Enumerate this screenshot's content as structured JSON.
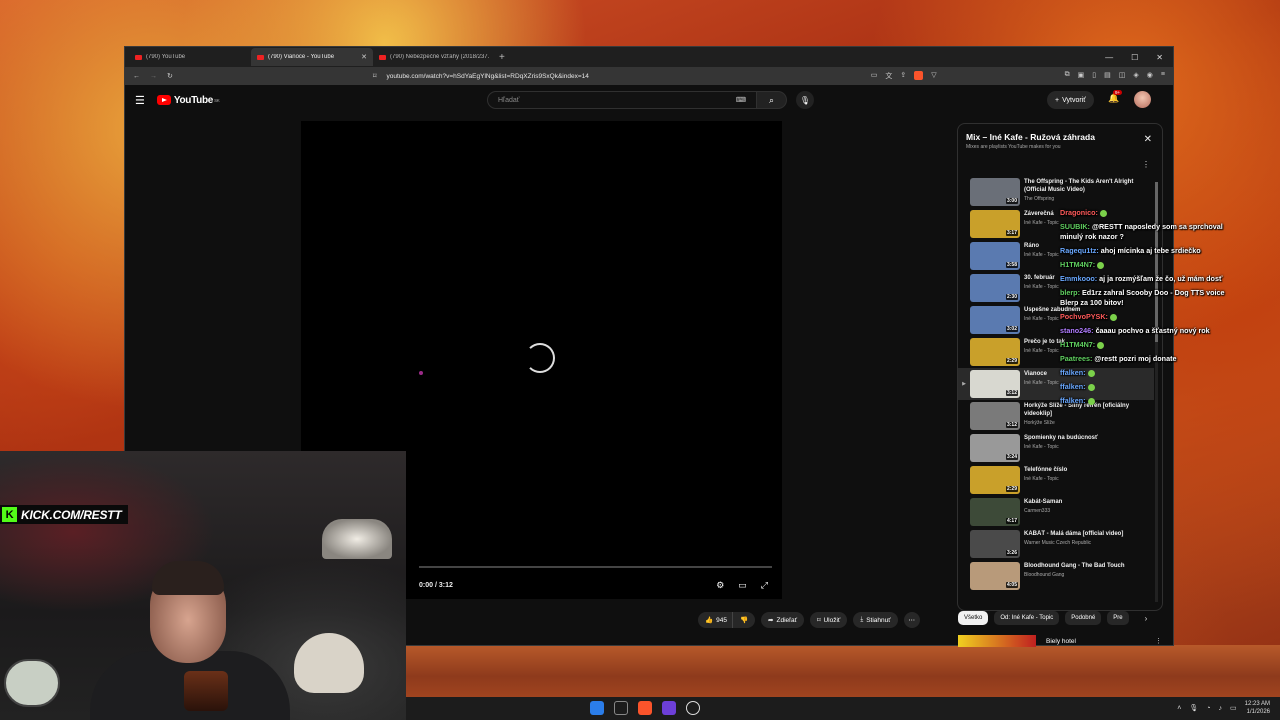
{
  "browser": {
    "tabs": [
      {
        "label": "(790) YouTube",
        "active": false
      },
      {
        "label": "(790) Vianoce - YouTube",
        "active": true
      },
      {
        "label": "(790) Nebezpečné vzťahy (2018/237...",
        "active": false
      }
    ],
    "new_tab": "+",
    "window_controls": {
      "minimize": "—",
      "maximize": "☐",
      "close": "✕"
    },
    "url": "youtube.com/watch?v=hSdYaEgYlNg&list=RDqXZris9SxQk&index=14"
  },
  "youtube": {
    "region": "SK",
    "search_placeholder": "Hľadať",
    "create_label": "Vytvoriť",
    "notifications_count": "9+",
    "player": {
      "time": "0:00 / 3:12"
    },
    "actions": {
      "like_count": "945",
      "share_label": "Zdieľať",
      "save_label": "Uložiť",
      "download_label": "Stiahnuť"
    },
    "playlist": {
      "title": "Mix – Iné Kafe - Ružová záhrada",
      "subtitle": "Mixes are playlists YouTube makes for you",
      "items": [
        {
          "title": "The Offspring - The Kids Aren't Alright (Official Music Video)",
          "channel": "The Offspring",
          "duration": "3:00",
          "thumb": "#6a6f78",
          "current": false
        },
        {
          "title": "Záverečná",
          "channel": "Iné Kafe - Topic",
          "duration": "3:17",
          "thumb": "#c9a02a",
          "current": false
        },
        {
          "title": "Ráno",
          "channel": "Iné Kafe - Topic",
          "duration": "3:58",
          "thumb": "#5a7ab0",
          "current": false
        },
        {
          "title": "30. február",
          "channel": "Iné Kafe - Topic",
          "duration": "2:30",
          "thumb": "#5a7ab0",
          "current": false
        },
        {
          "title": "Úspešne zabudnem",
          "channel": "Iné Kafe - Topic",
          "duration": "3:02",
          "thumb": "#5a7ab0",
          "current": false
        },
        {
          "title": "Prečo je to tak",
          "channel": "Iné Kafe - Topic",
          "duration": "2:29",
          "thumb": "#c9a02a",
          "current": false
        },
        {
          "title": "Vianoce",
          "channel": "Iné Kafe - Topic",
          "duration": "3:12",
          "thumb": "#d8d8d0",
          "current": true
        },
        {
          "title": "Horkýže Slíže - Silný refrén [oficiálny videoklip]",
          "channel": "Horkýže Slíže",
          "duration": "3:12",
          "thumb": "#7a7a7a",
          "current": false
        },
        {
          "title": "Spomienky na budúcnosť",
          "channel": "Iné Kafe - Topic",
          "duration": "3:24",
          "thumb": "#999999",
          "current": false
        },
        {
          "title": "Telefónne číslo",
          "channel": "Iné Kafe - Topic",
          "duration": "2:29",
          "thumb": "#c9a02a",
          "current": false
        },
        {
          "title": "Kabát-Šaman",
          "channel": "Carmen333",
          "duration": "4:17",
          "thumb": "#3d4a38",
          "current": false
        },
        {
          "title": "KABÁT - Malá dáma [official video]",
          "channel": "Warner Music Czech Republic",
          "duration": "3:26",
          "thumb": "#4a4a4a",
          "current": false
        },
        {
          "title": "Bloodhound Gang - The Bad Touch",
          "channel": "Bloodhound Gang",
          "duration": "4:05",
          "thumb": "#b89a7a",
          "current": false
        }
      ]
    },
    "chips": [
      "Všetko",
      "Od: Iné Kafe - Topic",
      "Podobné",
      "Pre"
    ],
    "next_video": {
      "title": "Biely hotel"
    }
  },
  "chat": [
    {
      "user": "Dragonico:",
      "text": "",
      "color": "r"
    },
    {
      "user": "SUUBIK:",
      "text": "@RESTT naposledy som sa sprchoval minulý rok nazor ?",
      "color": ""
    },
    {
      "user": "Ragequ1tz:",
      "text": "ahoj mícinka   aj tebe srdiečko",
      "color": "b"
    },
    {
      "user": "H1TM4N7:",
      "text": "",
      "color": ""
    },
    {
      "user": "Emmkooo:",
      "text": "aj ja rozmýšľam že čo, už mám dosť",
      "color": "b"
    },
    {
      "user": "blerp:",
      "text": "Ed1rz zahral Scooby Doo - Dog TTS voice Blerp za 100 bitov!",
      "color": ""
    },
    {
      "user": "PochvoPYSK:",
      "text": "",
      "color": "r"
    },
    {
      "user": "stano246:",
      "text": "čaaau pochvo a šťastný nový rok",
      "color": "p"
    },
    {
      "user": "H1TM4N7:",
      "text": "",
      "color": ""
    },
    {
      "user": "Paatrees:",
      "text": "@restt pozri moj donate",
      "color": ""
    },
    {
      "user": "ffalken:",
      "text": "",
      "color": "b"
    },
    {
      "user": "ffalken:",
      "text": "",
      "color": "b"
    },
    {
      "user": "ffalken:",
      "text": "",
      "color": "b"
    }
  ],
  "webcam": {
    "overlay_text": "KICK.COM/RESTT"
  },
  "taskbar": {
    "time": "12:23 AM",
    "date": "1/1/2026"
  },
  "colors": {
    "yt_red": "#ff0000",
    "kick_green": "#53fc18"
  }
}
